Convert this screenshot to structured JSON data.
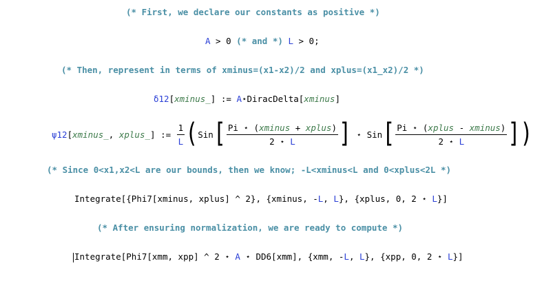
{
  "comment1": "(* First, we declare our constants as positive *)",
  "line2": {
    "a": "A",
    "gt1": " > 0",
    "cm": "(* and *)",
    "l": "L",
    "gt2": " > 0;"
  },
  "comment2": "(* Then, represent in terms of xminus=(x1-x2)/2 and xplus=(x1_x2)/2 *)",
  "delta": {
    "name": "δ12",
    "open": "[",
    "arg": "xminus_",
    "def": "] := ",
    "a": "A",
    "star": "⋆",
    "fn": "DiracDelta",
    "open2": "[",
    "arg2": "xminus",
    "close": "]"
  },
  "psi": {
    "name": "ψ12",
    "open": "[",
    "arg1": "xminus_",
    "sep": ", ",
    "arg2": "xplus_",
    "def": "] := ",
    "frac_num": "1",
    "frac_den": "L",
    "paren_open": "(",
    "sin1": "Sin",
    "br_open": "[",
    "f1_pi": "Pi",
    "f1_star": " ⋆ ",
    "f1_lp": "(",
    "f1_v1": "xminus",
    "f1_plus": " + ",
    "f1_v2": "xplus",
    "f1_rp": ")",
    "f1_den_two": "2",
    "f1_den_star": " ⋆ ",
    "f1_den_l": "L",
    "br_close": "]",
    "mid_star": " ⋆ ",
    "sin2": "Sin",
    "f2_pi": "Pi",
    "f2_star": " ⋆ ",
    "f2_lp": "(",
    "f2_v1": "xplus",
    "f2_minus": " - ",
    "f2_v2": "xminus",
    "f2_rp": ")",
    "f2_den_two": "2",
    "f2_den_star": " ⋆ ",
    "f2_den_l": "L",
    "close_all": "]",
    "paren_close": ")"
  },
  "comment3": "(* Since 0<x1,x2<L are our bounds, then we know; -L<xminus<L and 0<xplus<2L *)",
  "integrate1": {
    "t1": "Integrate[{",
    "phi": "Phi7",
    "t2": "[",
    "v1": "xminus",
    "t3": ", ",
    "v2": "xplus",
    "t4": "] ^ 2}, {",
    "v3": "xminus",
    "t5": ", -",
    "l1": "L",
    "t6": ", ",
    "l2": "L",
    "t7": "}, {",
    "v4": "xplus",
    "t8": ", 0, 2 ⋆ ",
    "l3": "L",
    "t9": "}]"
  },
  "comment4": "(* After ensuring normalization, we are ready to compute *)",
  "integrate2": {
    "t1": "Integrate[",
    "phi": "Phi7",
    "t2": "[",
    "v1": "xmm",
    "t3": ", ",
    "v2": "xpp",
    "t4": "] ^ 2 ⋆ ",
    "a": "A",
    "t5": " ⋆ ",
    "dd": "DD6",
    "t6": "[",
    "v3": "xmm",
    "t7": "], {",
    "v4": "xmm",
    "t8": ", -",
    "l1": "L",
    "t9": ", ",
    "l2": "L",
    "t10": "}, {",
    "v5": "xpp",
    "t11": ", 0, 2 ⋆ ",
    "l3": "L",
    "t12": "}]"
  },
  "colors": {
    "comment": "#4a8fa5",
    "symbol": "#2a3fd6",
    "pattern": "#3d7a4a",
    "text": "#000000"
  }
}
